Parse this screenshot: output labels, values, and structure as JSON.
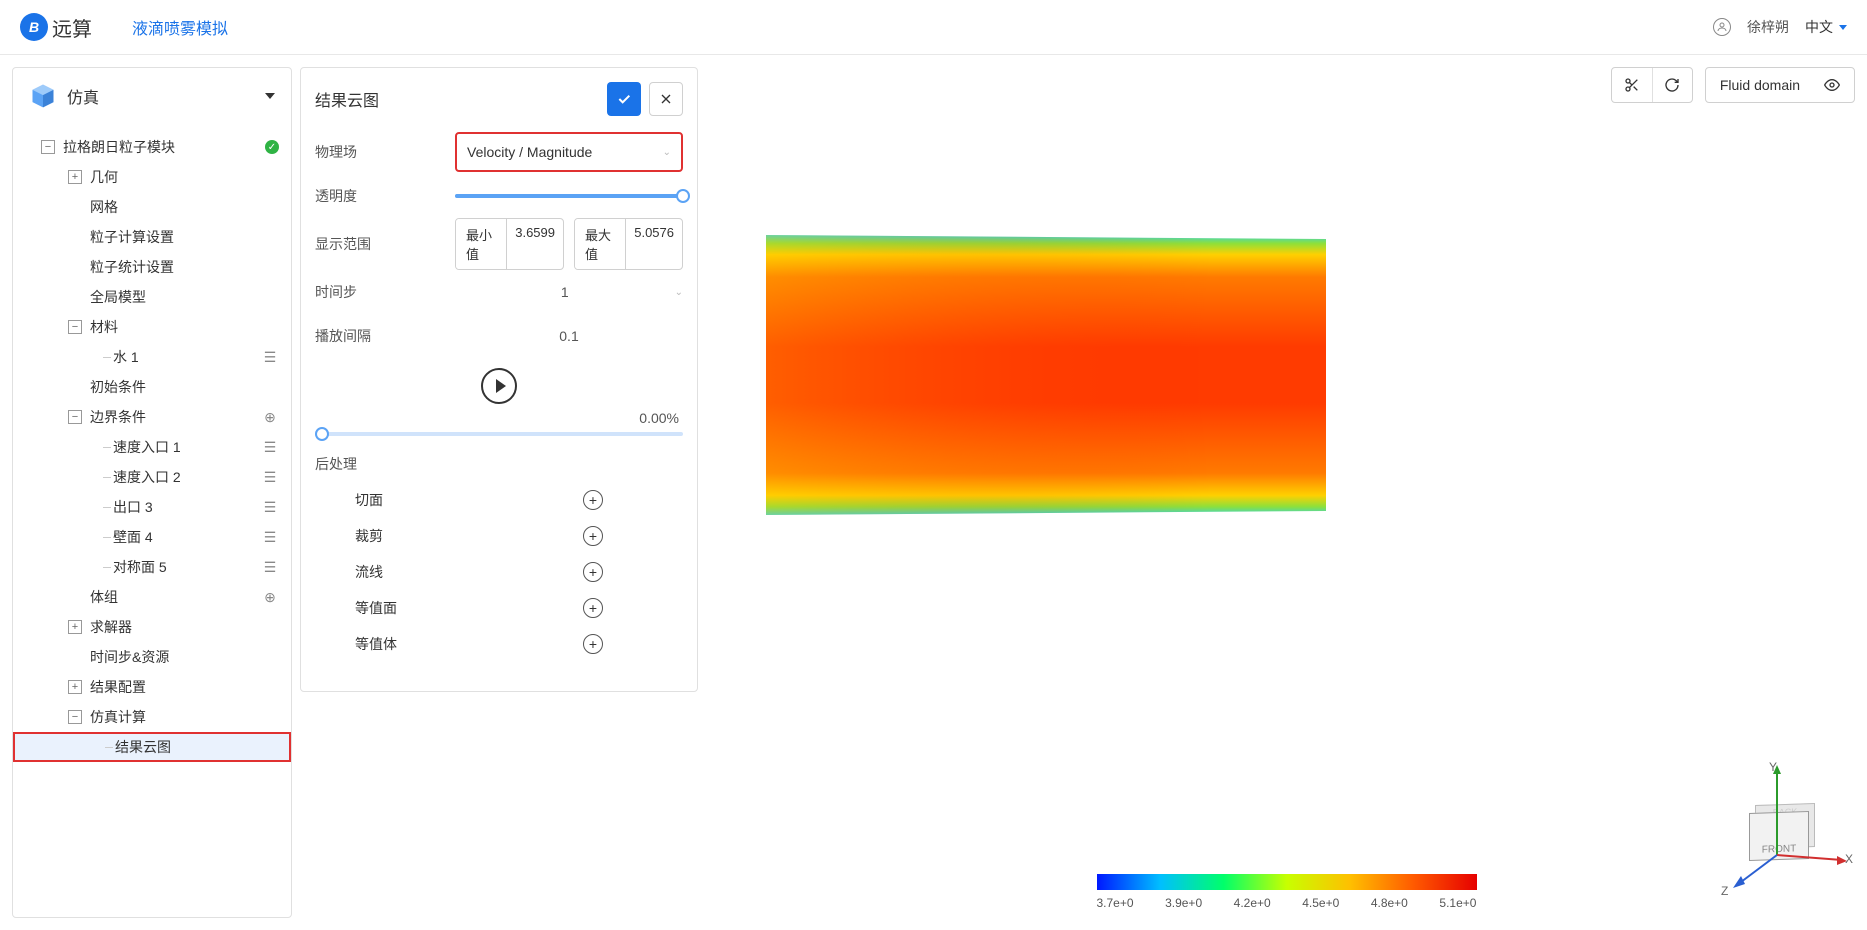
{
  "header": {
    "brand": "远算",
    "project_title": "液滴喷雾模拟",
    "user_name": "徐梓朔",
    "language": "中文"
  },
  "sidebar": {
    "title": "仿真",
    "tree": {
      "root": "拉格朗日粒子模块",
      "geometry": "几何",
      "mesh": "网格",
      "particle_calc": "粒子计算设置",
      "particle_stat": "粒子统计设置",
      "global_model": "全局模型",
      "materials": "材料",
      "water": "水 1",
      "initial_cond": "初始条件",
      "boundary_cond": "边界条件",
      "velocity_inlet_1": "速度入口 1",
      "velocity_inlet_2": "速度入口 2",
      "outlet_3": "出口 3",
      "wall_4": "壁面 4",
      "sym_5": "对称面 5",
      "body_group": "体组",
      "solver": "求解器",
      "timestep_res": "时间步&资源",
      "result_config": "结果配置",
      "sim_calc": "仿真计算",
      "result_contour": "结果云图"
    }
  },
  "props": {
    "title": "结果云图",
    "field_label": "物理场",
    "field_value": "Velocity / Magnitude",
    "opacity_label": "透明度",
    "range_label": "显示范围",
    "min_btn": "最小值",
    "min_val": "3.6599",
    "max_btn": "最大值",
    "max_val": "5.0576",
    "timestep_label": "时间步",
    "timestep_val": "1",
    "interval_label": "播放间隔",
    "interval_val": "0.1",
    "progress": "0.00%",
    "postproc_label": "后处理",
    "post_items": {
      "slice": "切面",
      "clip": "裁剪",
      "streamline": "流线",
      "isosurface": "等值面",
      "isovolume": "等值体"
    }
  },
  "viewport": {
    "domain_label": "Fluid domain",
    "legend_ticks": [
      "3.7e+0",
      "3.9e+0",
      "4.2e+0",
      "4.5e+0",
      "4.8e+0",
      "5.1e+0"
    ],
    "axes": {
      "x": "X",
      "y": "Y",
      "z": "Z"
    },
    "cube_front": "FRONT",
    "cube_back": "BACK"
  }
}
